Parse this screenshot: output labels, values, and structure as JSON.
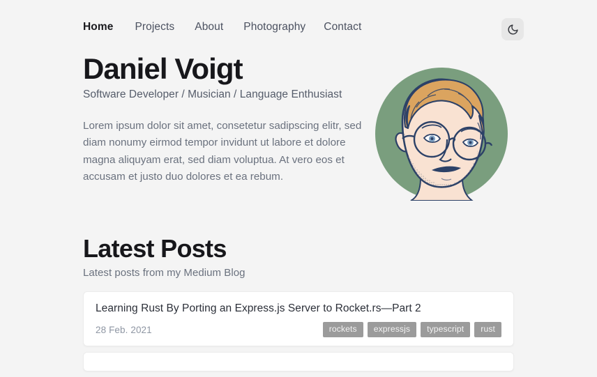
{
  "site": {
    "background_color": "#f4f4f4"
  },
  "nav": {
    "items": [
      {
        "label": "Home",
        "active": true
      },
      {
        "label": "Projects",
        "active": false
      },
      {
        "label": "About",
        "active": false
      },
      {
        "label": "Photography",
        "active": false
      },
      {
        "label": "Contact",
        "active": false
      }
    ],
    "theme_toggle": {
      "icon": "moon-icon",
      "label": "Toggle dark mode",
      "background_color": "#e7e7e7"
    }
  },
  "hero": {
    "name": "Daniel Voigt",
    "tagline": "Software Developer / Musician / Language Enthusiast",
    "bio": "Lorem ipsum dolor sit amet, consetetur sadipscing elitr, sed diam nonumy eirmod tempor invidunt ut labore et dolore magna aliquyam erat, sed diam voluptua. At vero eos et accusam et justo duo dolores et ea rebum.",
    "avatar": {
      "icon": "portrait-illustration",
      "alt": "Illustrated portrait of Daniel Voigt",
      "circle_color": "#7a9e7e",
      "skin_color": "#f9e2d2",
      "hair_color": "#dba45f",
      "outline_color": "#2c4167"
    }
  },
  "posts_section": {
    "title": "Latest Posts",
    "subtitle": "Latest posts from my Medium Blog",
    "cards": [
      {
        "title": "Learning Rust By Porting an Express.js Server to Rocket.rs—Part 2",
        "date": "28 Feb. 2021",
        "tags": [
          "rockets",
          "expressjs",
          "typescript",
          "rust"
        ]
      },
      {
        "title": "",
        "date": "",
        "tags": []
      }
    ]
  }
}
